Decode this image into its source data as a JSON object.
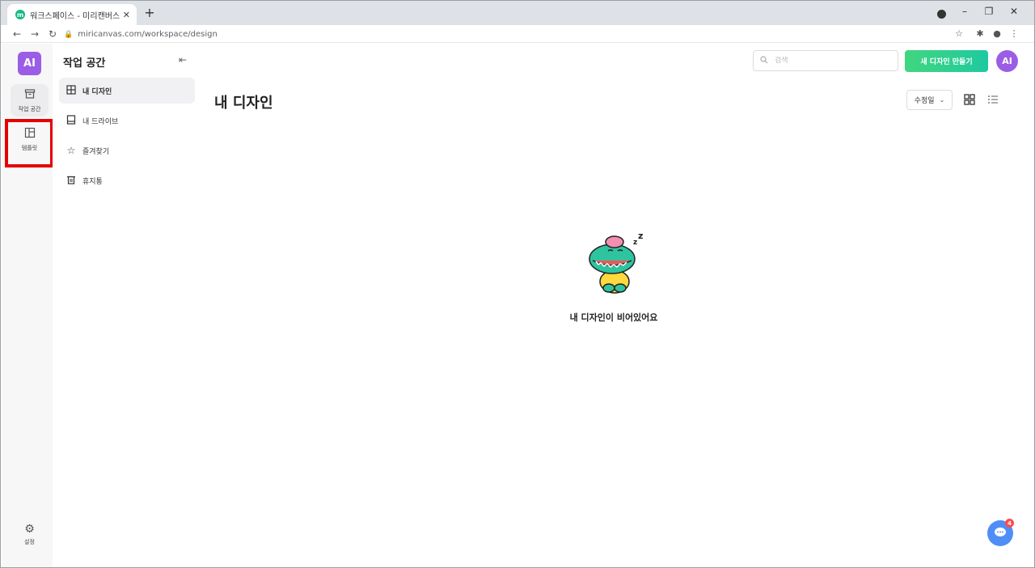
{
  "browser": {
    "tab_title": "워크스페이스 - 미리캔버스",
    "tab_favicon": "m",
    "tab_close": "✕",
    "new_tab": "+",
    "url": "miricanvas.com/workspace/design",
    "icons": [
      "back-arrow-icon",
      "forward-arrow-icon",
      "reload-icon",
      "lock-icon",
      "star-icon",
      "extension-icon",
      "profile-icon",
      "kebab-menu-icon"
    ]
  },
  "rail": {
    "avatar": "AI",
    "items": [
      {
        "label": "작업 공간",
        "icon": "archive-box-icon"
      },
      {
        "label": "템플릿",
        "icon": "layout-icon"
      }
    ],
    "settings_label": "설정"
  },
  "sidebar": {
    "title": "작업 공간",
    "items": [
      {
        "label": "내 디자인",
        "icon": "grid-icon"
      },
      {
        "label": "내 드라이브",
        "icon": "drive-icon"
      },
      {
        "label": "즐겨찾기",
        "icon": "star-icon"
      },
      {
        "label": "휴지통",
        "icon": "trash-icon"
      }
    ]
  },
  "header": {
    "search_placeholder": "검색",
    "new_design_label": "새 디자인 만들기",
    "user_avatar": "AI"
  },
  "main": {
    "title": "내 디자인",
    "sort_label": "수정일",
    "empty_text": "내 디자인이 비어있어요"
  },
  "chat": {
    "badge_count": "4"
  },
  "colors": {
    "brand_purple": "#9b5de5",
    "cta_green": "#41d67f",
    "chat_blue": "#4f8ef7",
    "highlight_red": "#e60000"
  }
}
